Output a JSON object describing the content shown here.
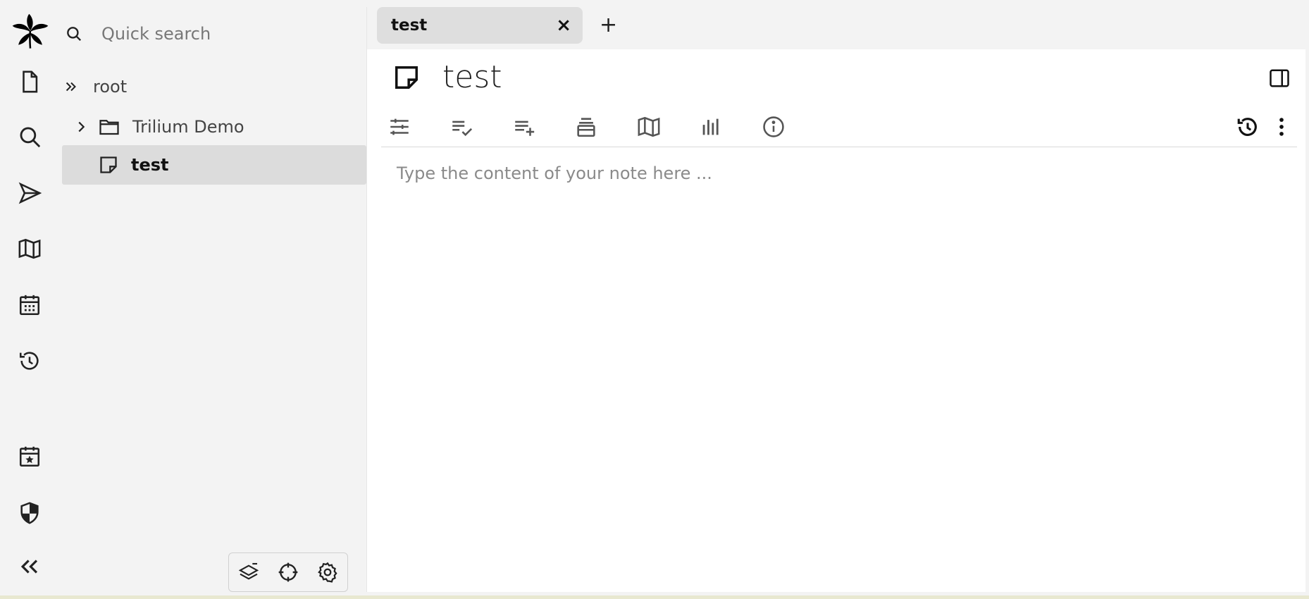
{
  "launcher": {
    "items": [
      {
        "icon": "trilium-logo-icon"
      },
      {
        "icon": "new-note-icon"
      },
      {
        "icon": "search-icon"
      },
      {
        "icon": "jump-to-note-icon"
      },
      {
        "icon": "note-map-icon"
      },
      {
        "icon": "calendar-icon"
      },
      {
        "icon": "recent-changes-icon"
      },
      {
        "icon": "today-note-icon"
      },
      {
        "icon": "protected-session-icon"
      },
      {
        "icon": "collapse-sidebar-icon"
      }
    ]
  },
  "tree": {
    "search_placeholder": "Quick search",
    "search_value": "",
    "hoist_label": "root",
    "items": [
      {
        "label": "Trilium Demo",
        "icon": "folder-icon",
        "expandable": true,
        "active": false
      },
      {
        "label": "test",
        "icon": "text-note-icon",
        "expandable": false,
        "active": true
      }
    ],
    "toolbar": [
      "collapse-tree-icon",
      "scroll-to-active-icon",
      "tree-settings-icon"
    ]
  },
  "tabs": [
    {
      "title": "test",
      "close": "×"
    }
  ],
  "new_tab_label": "+",
  "note": {
    "title": "test",
    "placeholder": "Type the content of your note here ..."
  },
  "ribbon": [
    "promoted-attributes-icon",
    "book-properties-icon",
    "owned-attributes-icon",
    "inherited-attributes-icon",
    "note-map-icon",
    "similar-notes-icon",
    "note-info-icon",
    "revisions-icon",
    "more-actions-icon"
  ],
  "colors": {
    "panel_bg": "#f3f3f3",
    "active_row": "#dcdcdc",
    "tab_bg": "#dedede",
    "content_bg": "#ffffff"
  }
}
